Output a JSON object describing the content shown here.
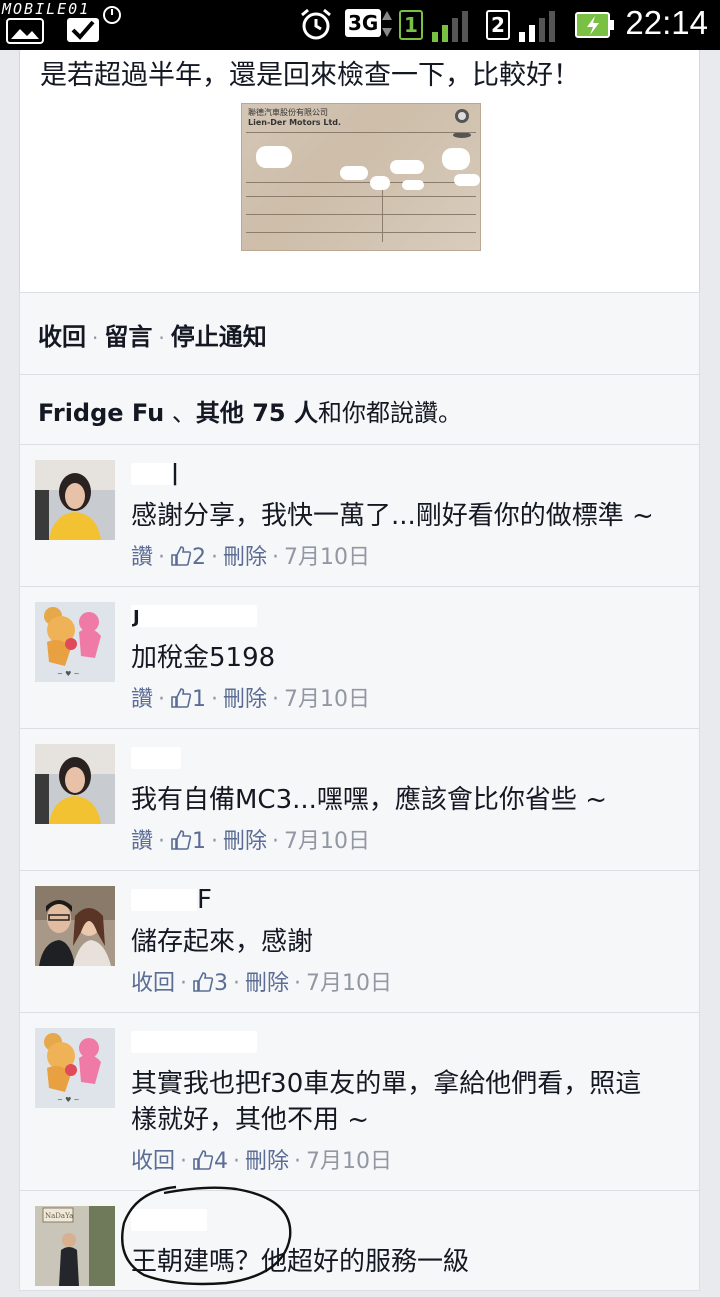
{
  "statusbar": {
    "watermark": "MOBILE01",
    "network": "3G",
    "sim1": "1",
    "sim2": "2",
    "time": "22:14"
  },
  "post": {
    "text": "是若超過半年，還是回來檢查一下，比較好！",
    "receipt_header_line1": "聯德汽車股份有限公司",
    "receipt_header_line2": "Lien-Der Motors Ltd."
  },
  "actions": {
    "collapse": "收回",
    "comment": "留言",
    "stop_notify": "停止通知"
  },
  "likes": {
    "name": "Fridge Fu",
    "sep": "、",
    "others": "其他 75 人",
    "suffix": "和你都說讚。"
  },
  "comments": [
    {
      "text": "感謝分享，我快一萬了...剛好看你的做標準 ~",
      "action": "讚",
      "likes": "2",
      "delete": "刪除",
      "date": "7月10日"
    },
    {
      "text": "加稅金5198",
      "action": "讚",
      "likes": "1",
      "delete": "刪除",
      "date": "7月10日"
    },
    {
      "text": "我有自備MC3...嘿嘿，應該會比你省些 ~",
      "action": "讚",
      "likes": "1",
      "delete": "刪除",
      "date": "7月10日"
    },
    {
      "text": "儲存起來，感謝",
      "name_tail": "F",
      "action": "收回",
      "likes": "3",
      "delete": "刪除",
      "date": "7月10日"
    },
    {
      "text": "其實我也把f30車友的單，拿給他們看，照這",
      "text2": "樣就好，其他不用 ~",
      "action": "收回",
      "likes": "4",
      "delete": "刪除",
      "date": "7月10日"
    },
    {
      "text": "王朝建嗎？他超好的服務一級",
      "avatar_label": "NaDaYa"
    }
  ],
  "colors": {
    "link": "#5b6c95",
    "date": "#9197a3",
    "text": "#141823",
    "battery": "#7ac143",
    "signal_active": "#7ac143"
  }
}
